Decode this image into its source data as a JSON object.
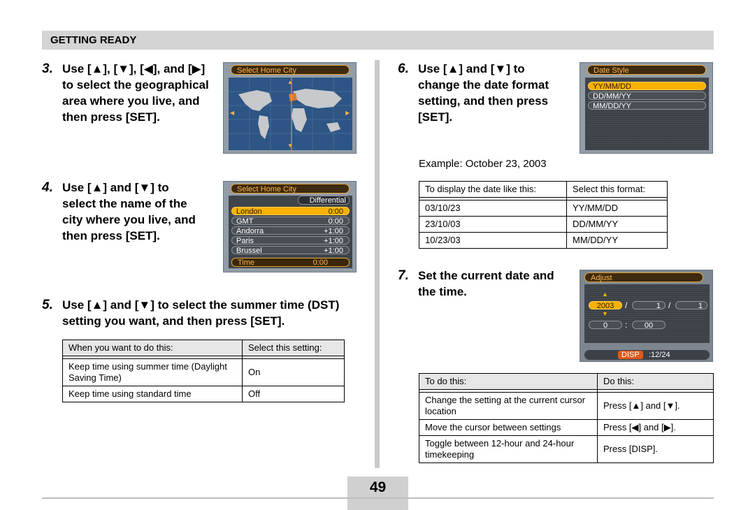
{
  "header": {
    "section": "GETTING READY"
  },
  "steps": {
    "s3": {
      "num": "3.",
      "text": "Use [▲], [▼], [◀], and [▶] to select the geographical area where you live, and then press [SET]."
    },
    "s4": {
      "num": "4.",
      "text": "Use [▲] and [▼] to select the name of the city where you live, and then press [SET]."
    },
    "s5": {
      "num": "5.",
      "text": "Use [▲] and [▼] to select the summer time (DST) setting you want, and then press [SET]."
    },
    "s6": {
      "num": "6.",
      "text": "Use [▲] and [▼] to change the date format setting, and then press [SET]."
    },
    "s7": {
      "num": "7.",
      "text": "Set the current date and the time."
    }
  },
  "screens": {
    "home_city_map": {
      "title": "Select Home City"
    },
    "home_city_list": {
      "title": "Select Home City",
      "column": "Differential",
      "rows": [
        {
          "city": "London",
          "offset": "0:00",
          "selected": true
        },
        {
          "city": "GMT",
          "offset": "0:00"
        },
        {
          "city": "Andorra",
          "offset": "+1:00"
        },
        {
          "city": "Paris",
          "offset": "+1:00"
        },
        {
          "city": "Brussel",
          "offset": "+1:00"
        }
      ],
      "time_label": "Time",
      "time_value": "0:00"
    },
    "date_style": {
      "title": "Date Style",
      "options": [
        "YY/MM/DD",
        "DD/MM/YY",
        "MM/DD/YY"
      ],
      "selected": 0
    },
    "adjust": {
      "title": "Adjust",
      "year": "2003",
      "month": "1",
      "day": "1",
      "sep1": "/",
      "sep2": "/",
      "hour": "0",
      "minute": "00",
      "time_sep": ":",
      "disp_label": "DISP",
      "disp_value": ":12/24"
    }
  },
  "dst_table": {
    "headers": [
      "When you want to do this:",
      "Select this setting:"
    ],
    "rows": [
      [
        "Keep time using summer time (Daylight Saving Time)",
        "On"
      ],
      [
        "Keep time using standard time",
        "Off"
      ]
    ]
  },
  "example_text": "Example: October 23, 2003",
  "date_table": {
    "headers": [
      "To display the date like this:",
      "Select this format:"
    ],
    "rows": [
      [
        "03/10/23",
        "YY/MM/DD"
      ],
      [
        "23/10/03",
        "DD/MM/YY"
      ],
      [
        "10/23/03",
        "MM/DD/YY"
      ]
    ]
  },
  "adjust_table": {
    "headers": [
      "To do this:",
      "Do this:"
    ],
    "rows": [
      [
        "Change the setting at the current cursor location",
        "Press [▲] and [▼]."
      ],
      [
        "Move the cursor between settings",
        "Press [◀] and [▶]."
      ],
      [
        "Toggle between 12-hour and 24-hour timekeeping",
        "Press [DISP]."
      ]
    ]
  },
  "page_number": "49"
}
